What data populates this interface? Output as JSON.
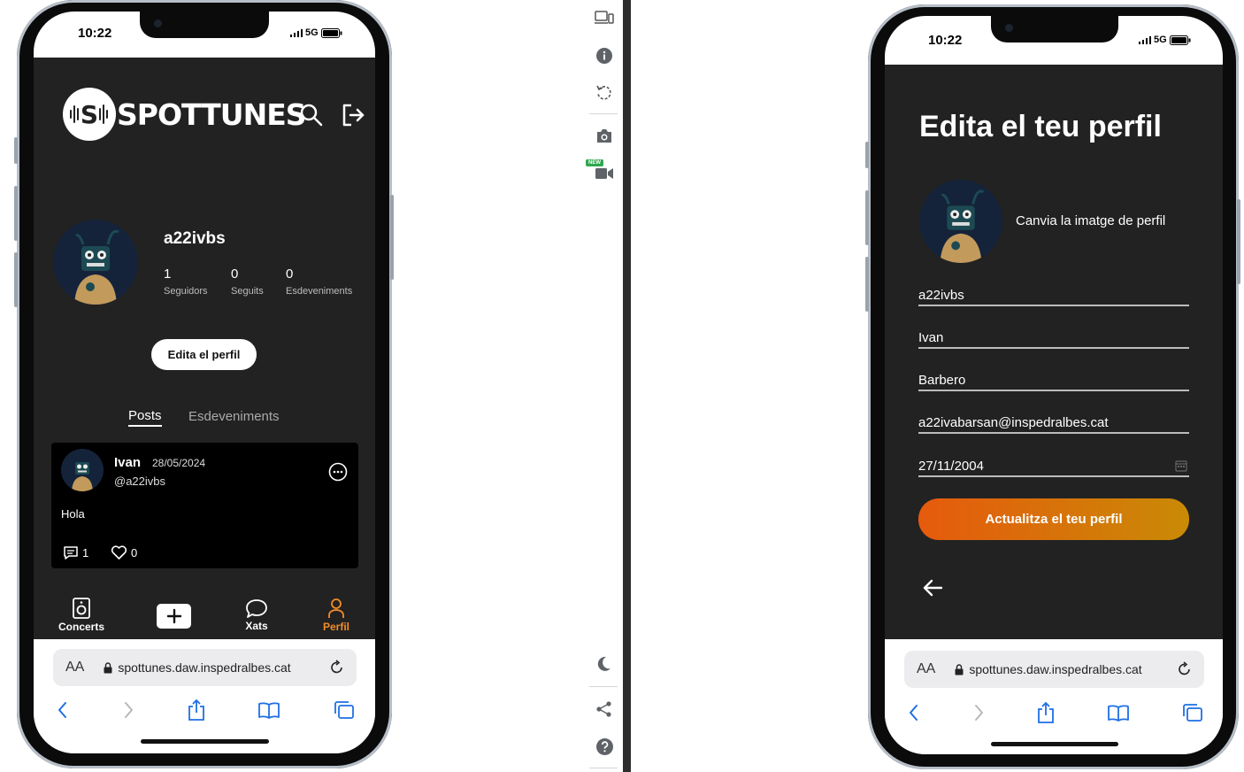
{
  "left": {
    "status": {
      "time": "10:22",
      "network": "5G"
    },
    "header": {
      "logo_text": "SPOTTUNES",
      "logo_mark": "S"
    },
    "profile": {
      "username": "a22ivbs",
      "stats": [
        {
          "value": "1",
          "label": "Seguidors"
        },
        {
          "value": "0",
          "label": "Seguits"
        },
        {
          "value": "0",
          "label": "Esdeveniments"
        }
      ],
      "edit_label": "Edita el perfil"
    },
    "tabs": [
      {
        "label": "Posts"
      },
      {
        "label": "Esdeveniments"
      }
    ],
    "post": {
      "author": "Ivan",
      "date": "28/05/2024",
      "handle": "@a22ivbs",
      "text": "Hola",
      "comments": "1",
      "likes": "0"
    },
    "nav": [
      {
        "label": "Concerts"
      },
      {
        "label": ""
      },
      {
        "label": "Xats"
      },
      {
        "label": "Perfil"
      }
    ],
    "nav_active_color": "#f28c28",
    "safari": {
      "aa": "AA",
      "url": "spottunes.daw.inspedralbes.cat"
    }
  },
  "right": {
    "status": {
      "time": "10:22",
      "network": "5G"
    },
    "title": "Edita el teu perfil",
    "change_image": "Canvia la imatge de perfil",
    "fields": [
      {
        "value": "a22ivbs"
      },
      {
        "value": "Ivan"
      },
      {
        "value": "Barbero"
      },
      {
        "value": "a22ivabarsan@inspedralbes.cat"
      },
      {
        "value": "27/11/2004"
      }
    ],
    "submit_label": "Actualitza el teu perfil",
    "safari": {
      "aa": "AA",
      "url": "spottunes.daw.inspedralbes.cat"
    }
  },
  "toolbar": {
    "new_badge": "NEW"
  },
  "colors": {
    "app_bg": "#222222",
    "accent_start": "#e65a0d",
    "accent_end": "#c98a06"
  }
}
